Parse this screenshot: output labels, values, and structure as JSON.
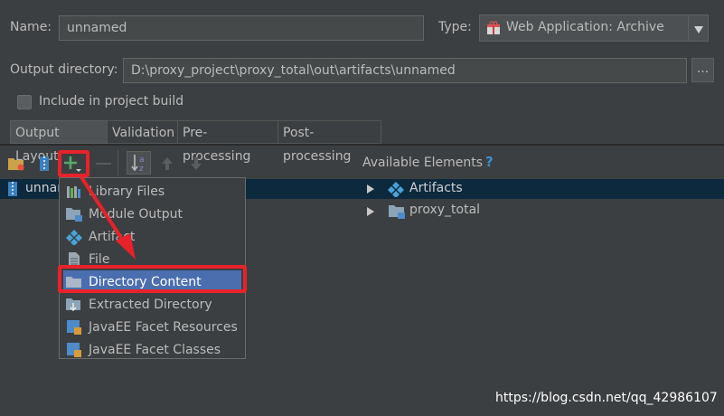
{
  "form": {
    "name_label": "Name:",
    "name_value": "unnamed",
    "type_label": "Type:",
    "type_value": "Web Application: Archive",
    "output_label": "Output directory:",
    "output_value": "D:\\proxy_project\\proxy_total\\out\\artifacts\\unnamed",
    "browse_label": "...",
    "include_label": "Include in project build"
  },
  "tabs": [
    {
      "label": "Output Layout"
    },
    {
      "label": "Validation"
    },
    {
      "label": "Pre-processing"
    },
    {
      "label": "Post-processing"
    }
  ],
  "layout_tree": {
    "root_label": "unnamed"
  },
  "available": {
    "header": "Available Elements",
    "help": "?",
    "items": [
      {
        "label": "Artifacts"
      },
      {
        "label": "proxy_total"
      }
    ]
  },
  "add_menu": {
    "items": [
      {
        "label": "Library Files"
      },
      {
        "label": "Module Output"
      },
      {
        "label": "Artifact"
      },
      {
        "label": "File"
      },
      {
        "label": "Directory Content"
      },
      {
        "label": "Extracted Directory"
      },
      {
        "label": "JavaEE Facet Resources"
      },
      {
        "label": "JavaEE Facet Classes"
      }
    ],
    "selected": "Directory Content"
  },
  "watermark": "https://blog.csdn.net/qq_42986107",
  "colors": {
    "background": "#3c3f41",
    "selection": "#4b6eaf",
    "annotation_red": "#e8222a",
    "add_green": "#59a869"
  },
  "icons": [
    "add-icon",
    "remove-icon",
    "sort-icon",
    "move-up-icon",
    "move-down-icon",
    "folder-icon",
    "archive-icon",
    "help-icon",
    "expand-arrow-icon",
    "dropdown-arrow-icon"
  ]
}
